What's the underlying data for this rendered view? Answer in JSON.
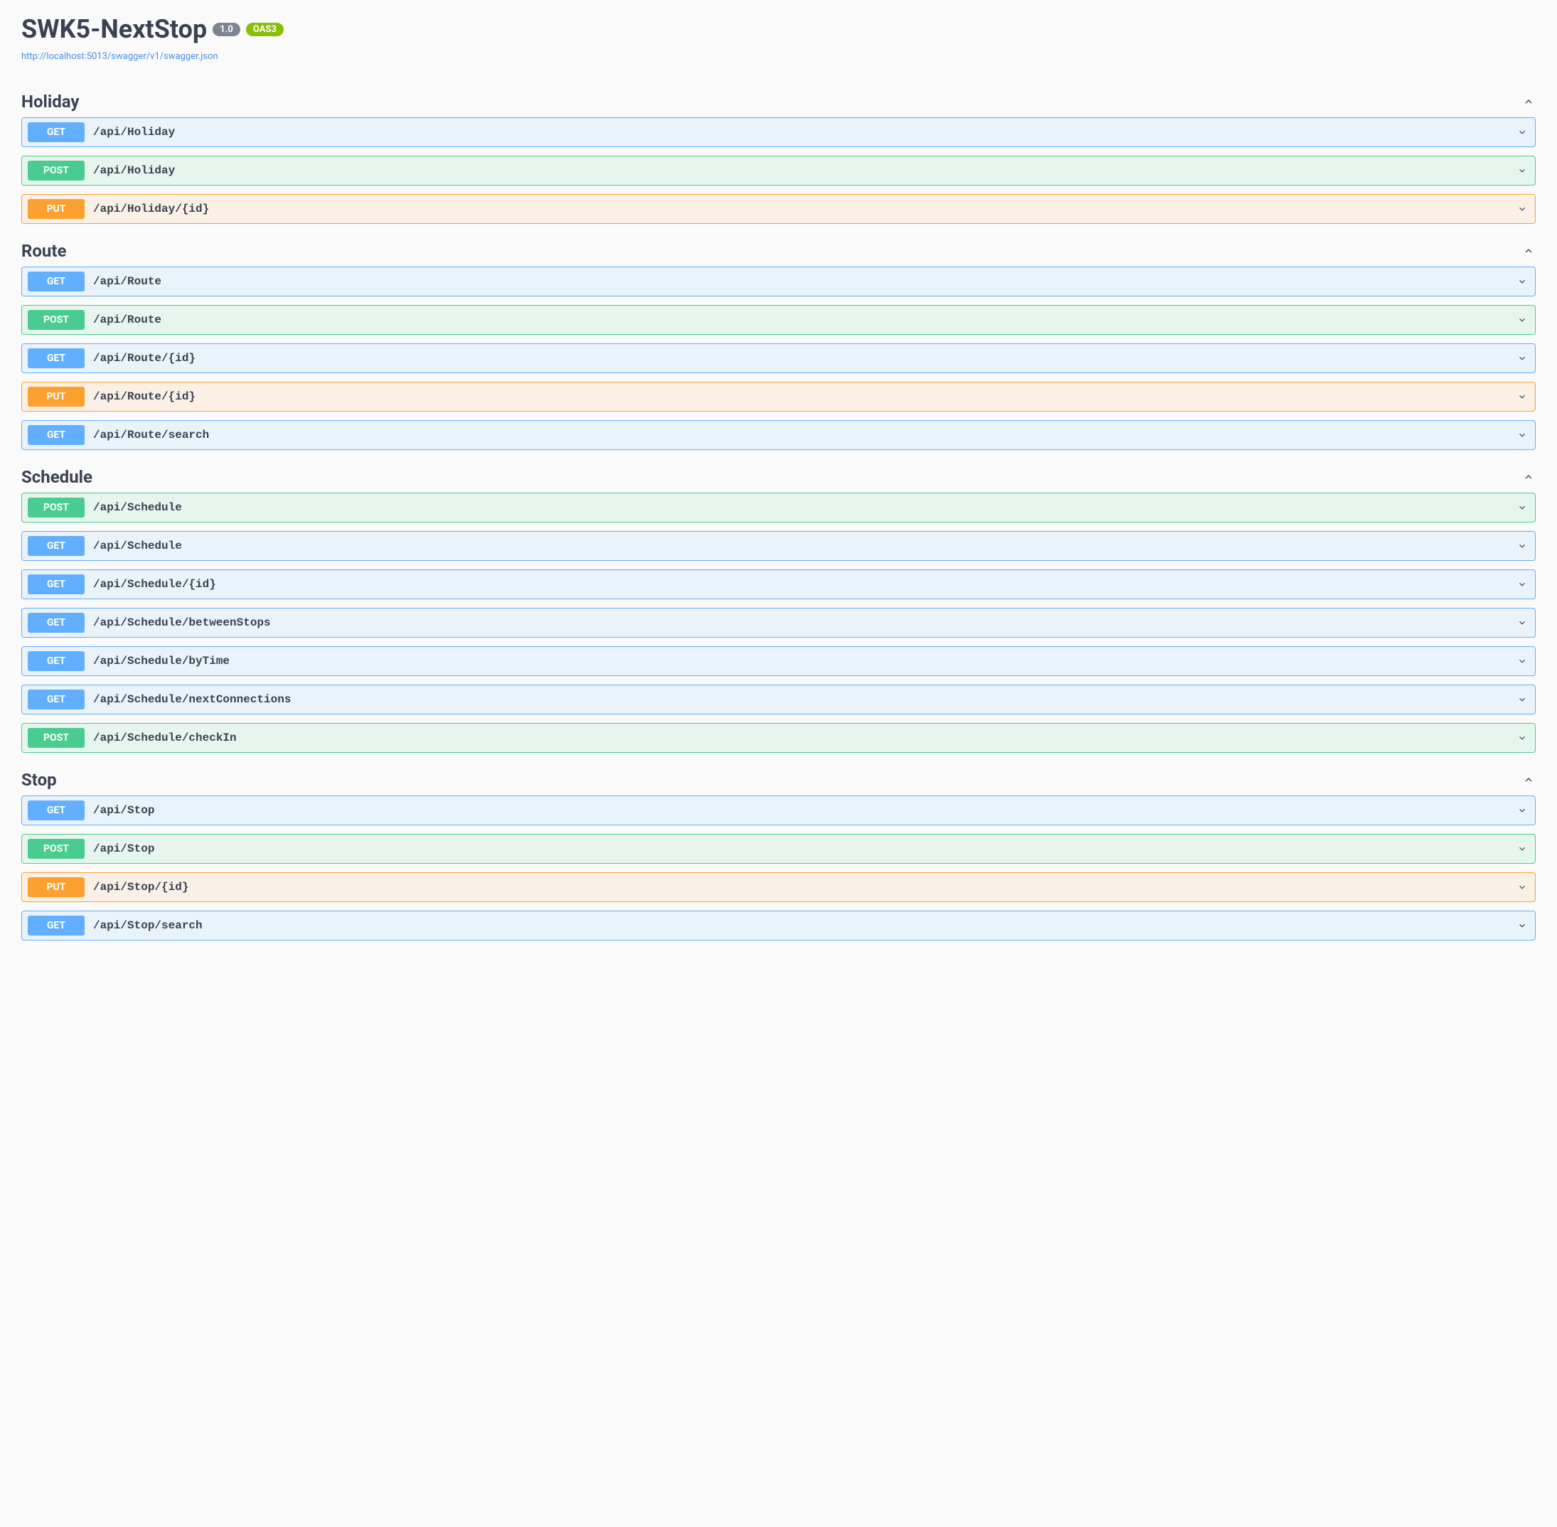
{
  "header": {
    "title": "SWK5-NextStop",
    "version": "1.0",
    "oas": "OAS3",
    "specUrl": "http://localhost:5013/swagger/v1/swagger.json"
  },
  "tags": [
    {
      "name": "Holiday",
      "operations": [
        {
          "method": "GET",
          "path": "/api/Holiday"
        },
        {
          "method": "POST",
          "path": "/api/Holiday"
        },
        {
          "method": "PUT",
          "path": "/api/Holiday/{id}"
        }
      ]
    },
    {
      "name": "Route",
      "operations": [
        {
          "method": "GET",
          "path": "/api/Route"
        },
        {
          "method": "POST",
          "path": "/api/Route"
        },
        {
          "method": "GET",
          "path": "/api/Route/{id}"
        },
        {
          "method": "PUT",
          "path": "/api/Route/{id}"
        },
        {
          "method": "GET",
          "path": "/api/Route/search"
        }
      ]
    },
    {
      "name": "Schedule",
      "operations": [
        {
          "method": "POST",
          "path": "/api/Schedule"
        },
        {
          "method": "GET",
          "path": "/api/Schedule"
        },
        {
          "method": "GET",
          "path": "/api/Schedule/{id}"
        },
        {
          "method": "GET",
          "path": "/api/Schedule/betweenStops"
        },
        {
          "method": "GET",
          "path": "/api/Schedule/byTime"
        },
        {
          "method": "GET",
          "path": "/api/Schedule/nextConnections"
        },
        {
          "method": "POST",
          "path": "/api/Schedule/checkIn"
        }
      ]
    },
    {
      "name": "Stop",
      "operations": [
        {
          "method": "GET",
          "path": "/api/Stop"
        },
        {
          "method": "POST",
          "path": "/api/Stop"
        },
        {
          "method": "PUT",
          "path": "/api/Stop/{id}"
        },
        {
          "method": "GET",
          "path": "/api/Stop/search"
        }
      ]
    }
  ]
}
